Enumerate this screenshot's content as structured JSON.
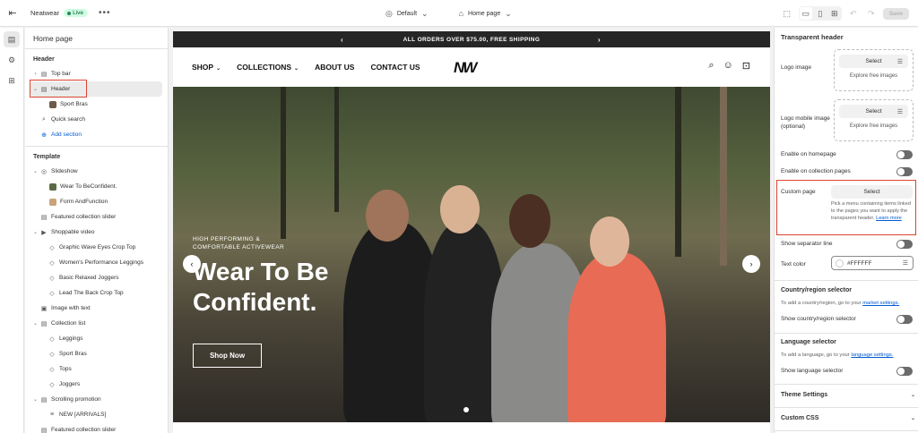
{
  "topbar": {
    "store_name": "Neatwear",
    "live_badge": "Live",
    "more_label": "•••",
    "theme_label": "Default",
    "page_label": "Home page",
    "save_label": "Save"
  },
  "left_panel": {
    "title": "Home page",
    "header_section": "Header",
    "header_items": [
      {
        "label": "Top bar"
      },
      {
        "label": "Header"
      },
      {
        "label": "Sport Bras"
      },
      {
        "label": "Quick search"
      },
      {
        "label": "Add section"
      }
    ],
    "template_section": "Template",
    "template_items": [
      {
        "label": "Slideshow"
      },
      {
        "label": "Wear To BeConfident."
      },
      {
        "label": "Form AndFunction"
      },
      {
        "label": "Featured collection slider"
      },
      {
        "label": "Shoppable video"
      },
      {
        "label": "Graphic Wave Eyes Crop Top"
      },
      {
        "label": "Women's Performance Leggings"
      },
      {
        "label": "Basic Relaxed Joggers"
      },
      {
        "label": "Lead The Back Crop Top"
      },
      {
        "label": "Image with text"
      },
      {
        "label": "Collection list"
      },
      {
        "label": "Leggings"
      },
      {
        "label": "Sport Bras"
      },
      {
        "label": "Tops"
      },
      {
        "label": "Joggers"
      },
      {
        "label": "Scrolling promotion"
      },
      {
        "label": "NEW [ARRIVALS]"
      },
      {
        "label": "Featured collection slider"
      }
    ]
  },
  "site": {
    "announcement": "ALL ORDERS OVER $75.00, FREE SHIPPING",
    "nav": [
      "SHOP",
      "COLLECTIONS",
      "ABOUT US",
      "CONTACT US"
    ],
    "logo": "NW",
    "hero_subtitle": "HIGH PERFORMING & COMFORTABLE ACTIVEWEAR",
    "hero_title": "Wear To Be Confident.",
    "hero_button": "Shop Now"
  },
  "right_panel": {
    "title": "Transparent header",
    "logo_image_label": "Logo image",
    "select_label": "Select",
    "explore_label": "Explore free images",
    "logo_mobile_label": "Logo mobile image (optional)",
    "enable_home": "Enable on homepage",
    "enable_collection": "Enable on collection pages",
    "custom_page": "Custom page",
    "custom_help": "Pick a menu containing items linked to the pages you want to apply the transparent header.",
    "learn_more": "Learn more",
    "separator": "Show separator line",
    "text_color_label": "Text color",
    "text_color_value": "#FFFFFF",
    "country_title": "Country/region selector",
    "country_help_pre": "To add a country/region, go to your",
    "country_help_link": "market settings.",
    "country_toggle": "Show country/region selector",
    "language_title": "Language selector",
    "language_help_pre": "To add a language, go to your",
    "language_help_link": "language settings.",
    "language_toggle": "Show language selector",
    "theme_settings": "Theme Settings",
    "custom_css": "Custom CSS"
  },
  "colors": {
    "accent_link": "#005bd3",
    "highlight": "#d9452f",
    "live_bg": "#cdfee1"
  }
}
